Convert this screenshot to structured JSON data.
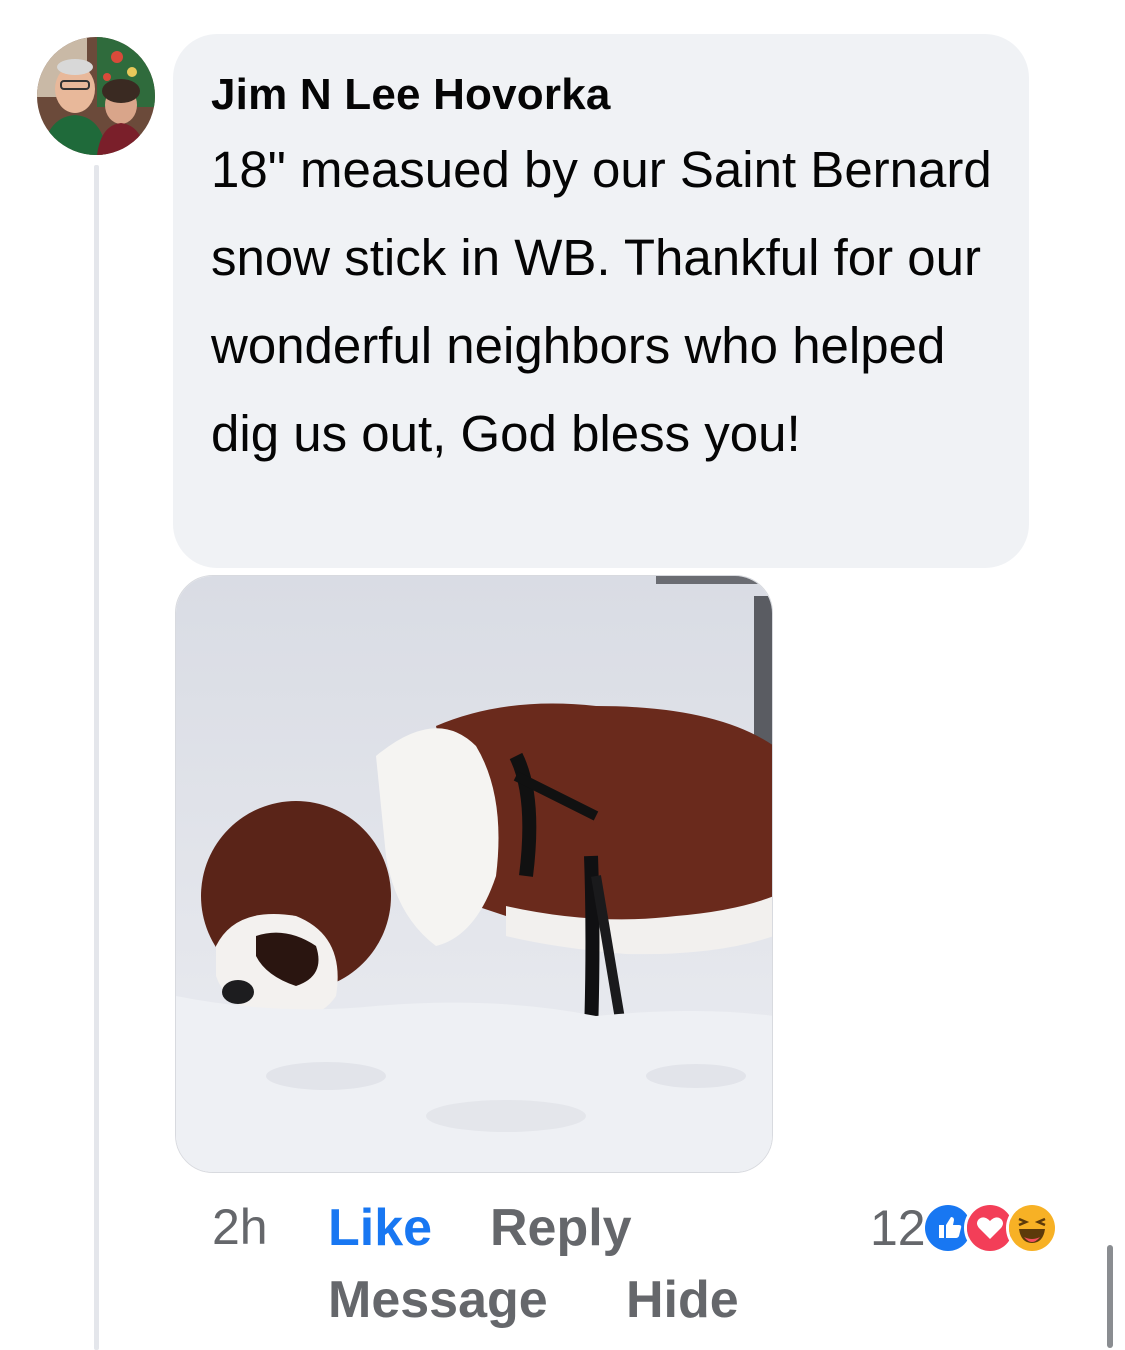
{
  "comment": {
    "author": "Jim N Lee Hovorka",
    "text": "18\" measued by our Saint Bernard snow stick in WB. Thankful for our wonderful neighbors who helped dig us out, God bless you!",
    "timestamp": "2h",
    "actions": {
      "like": "Like",
      "reply": "Reply",
      "message": "Message",
      "hide": "Hide"
    },
    "reactions": {
      "count": "12",
      "icons": [
        "like-icon",
        "love-icon",
        "haha-icon"
      ]
    }
  },
  "colors": {
    "bubble_bg": "#f0f2f5",
    "like_blue": "#1877f2",
    "muted_text": "#65676b",
    "love_red": "#f33e58",
    "haha_yellow": "#f7b125"
  }
}
